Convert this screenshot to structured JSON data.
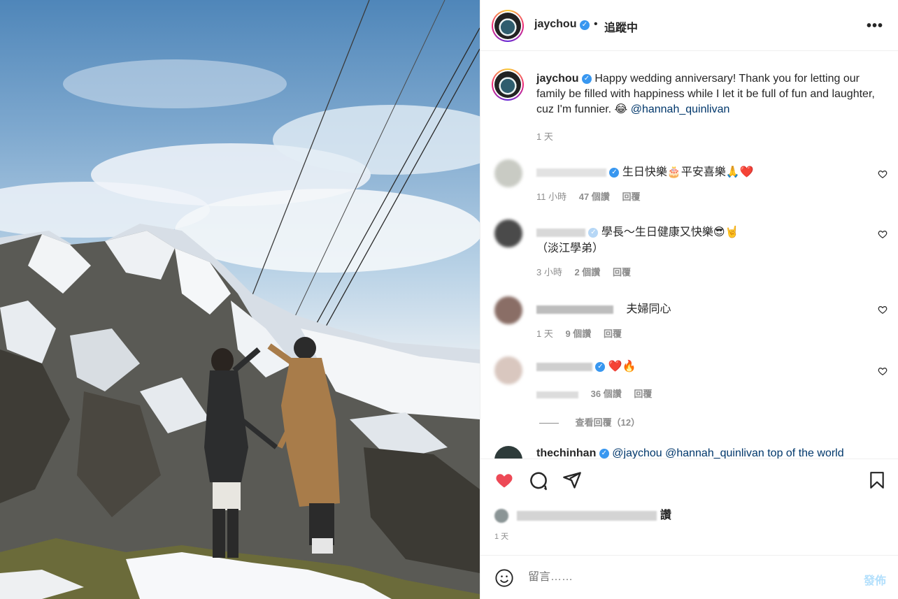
{
  "post": {
    "username": "jaychou",
    "follow_status": "追蹤中",
    "more_icon": "more-horizontal-icon",
    "caption_username": "jaychou",
    "caption_text": "Happy wedding anniversary! Thank you for letting our family be filled with happiness while I let it be full of fun and laughter, cuz I'm funnier. 😂",
    "caption_mention": "@hannah_quinlivan",
    "caption_time": "1 天"
  },
  "comments": [
    {
      "username": "original_poping",
      "text": "生日快樂🎂平安喜樂🙏❤️",
      "time": "11 小時",
      "likes": "47 個讚",
      "reply": "回覆"
    },
    {
      "username": "229",
      "text": "學長～生日健康又快樂😎🤘",
      "text2": "（淡江學弟）",
      "time": "3 小時",
      "likes": "2 個讚",
      "reply": "回覆"
    },
    {
      "username": "",
      "text": "夫婦同心",
      "time": "1 天",
      "likes": "9 個讚",
      "reply": "回覆"
    },
    {
      "username": "vanessswu",
      "text": "❤️🔥",
      "time": "",
      "likes": "36 個讚",
      "reply": "回覆"
    }
  ],
  "view_replies": "查看回覆（12）",
  "partial_comment": {
    "username": "thechinhan",
    "text": "@jaychou @hannah_quinlivan top of the world"
  },
  "actions": {
    "like_icon": "heart-filled-icon",
    "comment_icon": "comment-icon",
    "share_icon": "share-icon",
    "save_icon": "bookmark-icon",
    "likes_text": "讚",
    "time_text": "1 天"
  },
  "add_comment": {
    "emoji_icon": "smiley-icon",
    "placeholder": "留言……",
    "post_label": "發佈"
  },
  "colors": {
    "like_red": "#ed4956",
    "verified_blue": "#3897f0",
    "mention_blue": "#00376b",
    "muted_text": "#8e8e8e",
    "post_button_disabled": "#b2dffc"
  }
}
